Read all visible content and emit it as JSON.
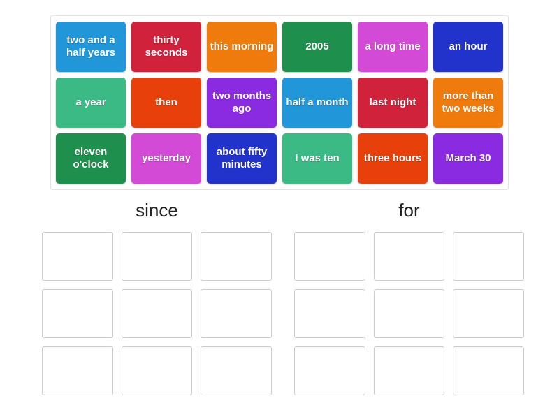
{
  "activity": {
    "type": "group-sort",
    "tile_text_color": "#ffffff",
    "container_border_color": "#e2e2e2",
    "slot_border_color": "#cccccc",
    "page_background": "#ffffff"
  },
  "wordbank": {
    "tiles": [
      {
        "label": "two and a half years",
        "color": "#2196d9"
      },
      {
        "label": "thirty seconds",
        "color": "#d0223a"
      },
      {
        "label": "this morning",
        "color": "#ef7b0d"
      },
      {
        "label": "2005",
        "color": "#1f8f4e"
      },
      {
        "label": "a long time",
        "color": "#d24ad6"
      },
      {
        "label": "an hour",
        "color": "#2233cc"
      },
      {
        "label": "a year",
        "color": "#3cba86"
      },
      {
        "label": "then",
        "color": "#e8400a"
      },
      {
        "label": "two months ago",
        "color": "#8a2be2"
      },
      {
        "label": "half a month",
        "color": "#2196d9"
      },
      {
        "label": "last night",
        "color": "#d0223a"
      },
      {
        "label": "more than two weeks",
        "color": "#ef7b0d"
      },
      {
        "label": "eleven o'clock",
        "color": "#1f8f4e"
      },
      {
        "label": "yesterday",
        "color": "#d24ad6"
      },
      {
        "label": "about fifty minutes",
        "color": "#2233cc"
      },
      {
        "label": "I was ten",
        "color": "#3cba86"
      },
      {
        "label": "three hours",
        "color": "#e8400a"
      },
      {
        "label": "March 30",
        "color": "#8a2be2"
      }
    ]
  },
  "categories": [
    {
      "title": "since",
      "slots": [
        "",
        "",
        "",
        "",
        "",
        "",
        "",
        "",
        ""
      ]
    },
    {
      "title": "for",
      "slots": [
        "",
        "",
        "",
        "",
        "",
        "",
        "",
        "",
        ""
      ]
    }
  ]
}
